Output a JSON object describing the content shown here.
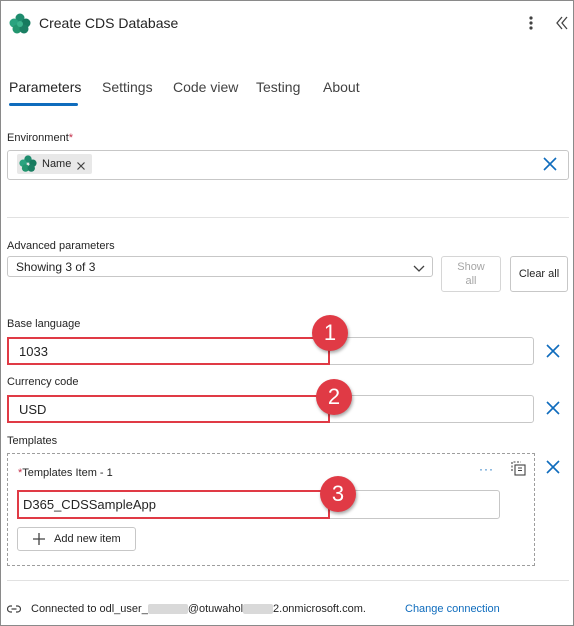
{
  "header": {
    "title": "Create CDS Database"
  },
  "tabs": [
    {
      "label": "Parameters"
    },
    {
      "label": "Settings"
    },
    {
      "label": "Code view"
    },
    {
      "label": "Testing"
    },
    {
      "label": "About"
    }
  ],
  "environment": {
    "label": "Environment",
    "required_mark": "*",
    "token": "Name"
  },
  "advanced": {
    "label": "Advanced parameters",
    "dropdown_value": "Showing 3 of 3",
    "show_all": "Show all",
    "clear_all": "Clear all"
  },
  "base_language": {
    "label": "Base language",
    "value": "1033"
  },
  "currency_code": {
    "label": "Currency code",
    "value": "USD"
  },
  "templates": {
    "label": "Templates",
    "item_required_mark": "*",
    "item_label": "Templates Item - 1",
    "item_value": "D365_CDSSampleApp",
    "more": "···",
    "add_new_item": "Add new item"
  },
  "callouts": [
    "1",
    "2",
    "3"
  ],
  "footer": {
    "connected_prefix": "Connected to odl_user_",
    "connected_mid": "@otuwahol",
    "connected_suffix": "2.onmicrosoft.com.",
    "change_connection": "Change connection"
  },
  "colors": {
    "accent": "#0f6cbd",
    "callout": "#e03a45",
    "required": "#c4314b"
  }
}
